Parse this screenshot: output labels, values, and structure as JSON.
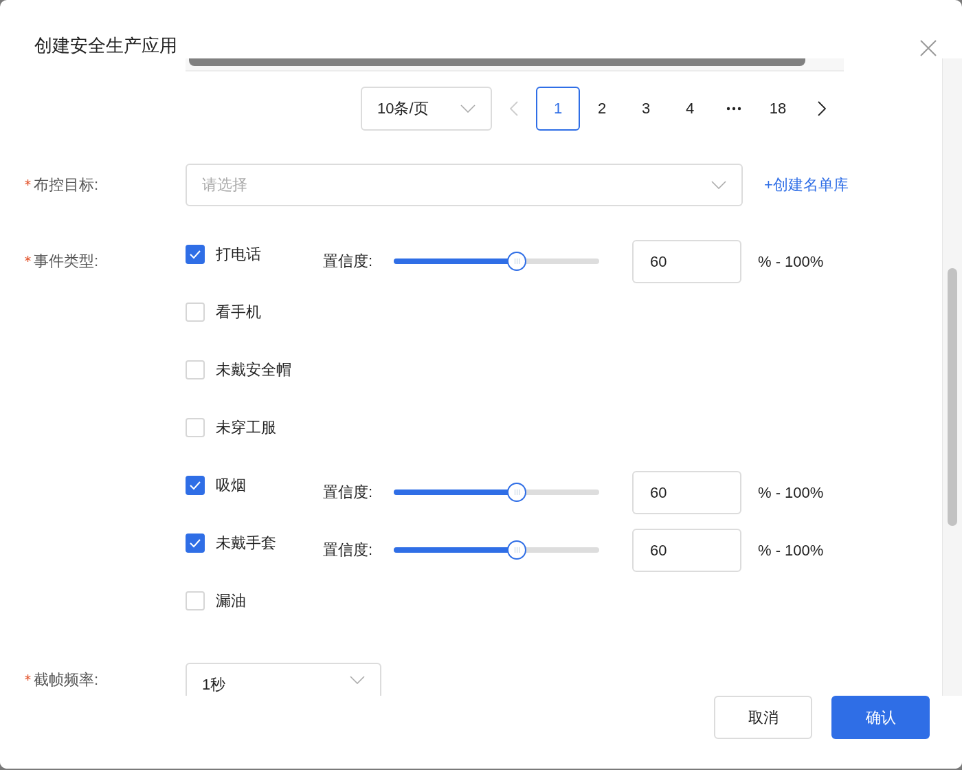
{
  "dialog": {
    "title": "创建安全生产应用"
  },
  "pagination": {
    "page_size": "10条/页",
    "prev": {
      "disabled": true
    },
    "next": {
      "disabled": false
    },
    "pages": [
      {
        "kind": "page",
        "label": "1",
        "selected": true
      },
      {
        "kind": "page",
        "label": "2",
        "selected": false
      },
      {
        "kind": "page",
        "label": "3",
        "selected": false
      },
      {
        "kind": "page",
        "label": "4",
        "selected": false
      },
      {
        "kind": "ellipsis"
      },
      {
        "kind": "page",
        "label": "18",
        "selected": false
      }
    ]
  },
  "target": {
    "label": "布控目标:",
    "required": true,
    "placeholder": "请选择",
    "link": "+创建名单库"
  },
  "events": {
    "label": "事件类型:",
    "required": true,
    "items": [
      {
        "label": "打电话",
        "checked": true,
        "confidence_label": "置信度:",
        "level": 0.6,
        "value": "60",
        "range": "% - 100%"
      },
      {
        "label": "看手机",
        "checked": false
      },
      {
        "label": "未戴安全帽",
        "checked": false
      },
      {
        "label": "未穿工服",
        "checked": false
      },
      {
        "label": "吸烟",
        "checked": true,
        "confidence_label": "置信度:",
        "level": 0.6,
        "value": "60",
        "range": "% - 100%"
      },
      {
        "label": "未戴手套",
        "checked": true,
        "confidence_label": "置信度:",
        "level": 0.6,
        "value": "60",
        "range": "% - 100%"
      },
      {
        "label": "漏油",
        "checked": false
      }
    ]
  },
  "frequency": {
    "label": "截帧频率:",
    "required": true,
    "value": "1秒"
  },
  "buttons": [
    {
      "label": "取消",
      "kind": "default"
    },
    {
      "label": "确认",
      "kind": "primary"
    }
  ]
}
